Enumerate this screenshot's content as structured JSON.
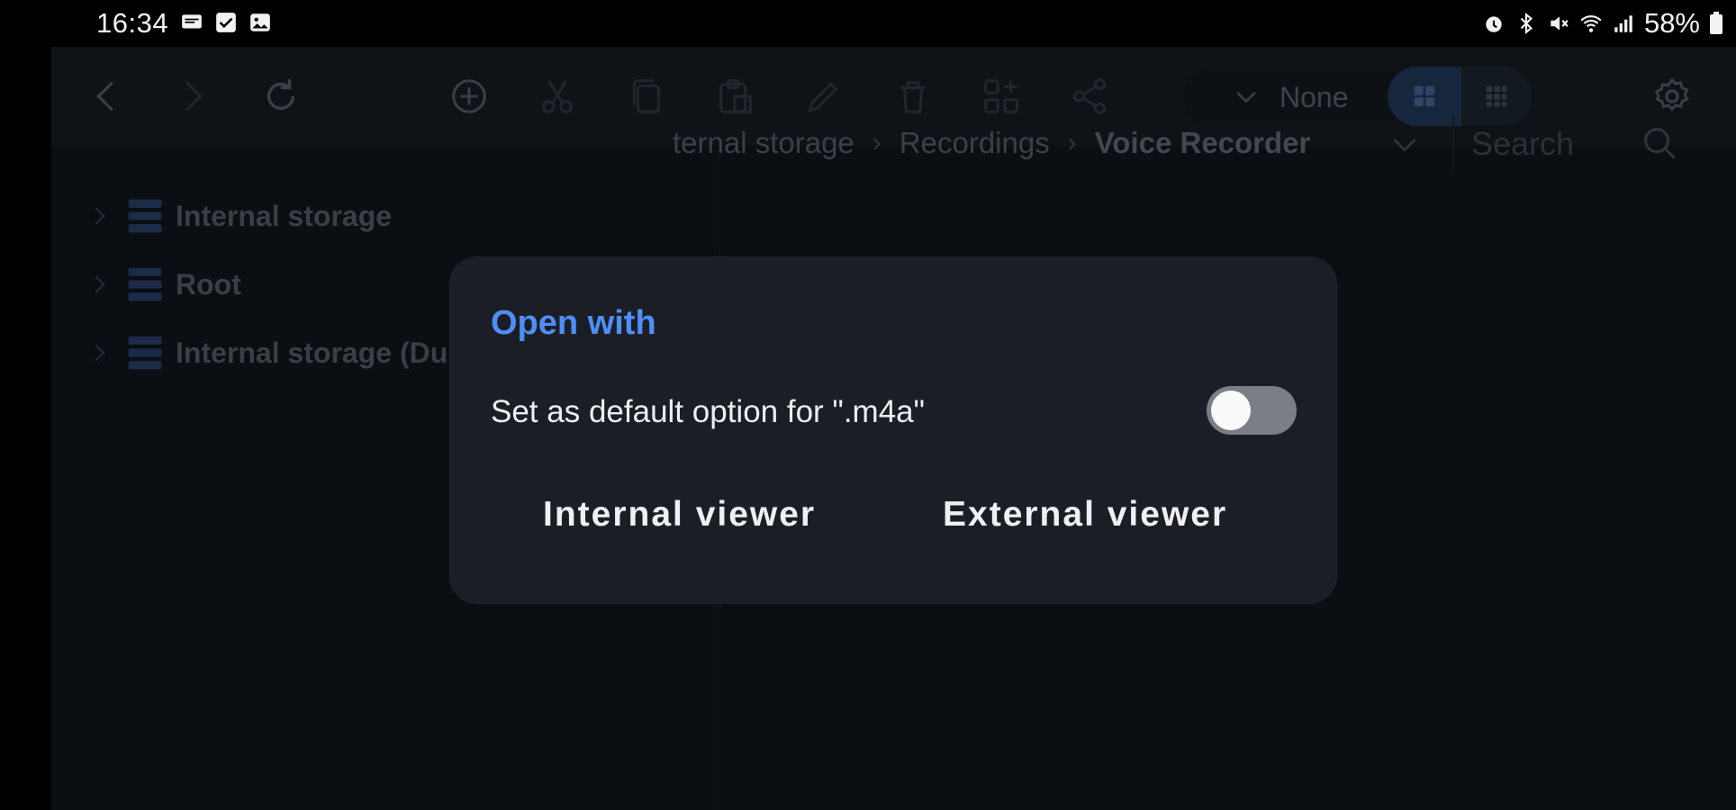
{
  "status_bar": {
    "time": "16:34",
    "left_icons": [
      "message-icon",
      "check-icon",
      "image-icon"
    ],
    "right_icons": [
      "alarm-icon",
      "bluetooth-icon",
      "mute-icon",
      "wifi-icon",
      "signal-icon"
    ],
    "battery": "58%"
  },
  "toolbar": {
    "buttons": [
      "back",
      "forward",
      "refresh",
      "add",
      "cut",
      "copy",
      "paste",
      "rename",
      "delete",
      "select",
      "share"
    ],
    "sort_value": "None",
    "view_modes": [
      "grid-large",
      "grid-small"
    ],
    "active_view": "grid-large"
  },
  "sidebar": {
    "items": [
      {
        "label": "Internal storage"
      },
      {
        "label": "Root"
      },
      {
        "label": "Internal storage (Du"
      }
    ]
  },
  "breadcrumb": {
    "items": [
      "ternal storage",
      "Recordings",
      "Voice Recorder"
    ]
  },
  "search": {
    "placeholder": "Search"
  },
  "dialog": {
    "title": "Open with",
    "default_option_label": "Set as default option for \".m4a\"",
    "default_toggle_on": false,
    "buttons": {
      "internal": "Internal viewer",
      "external": "External viewer"
    }
  },
  "colors": {
    "accent": "#4f8ef7",
    "dialog_bg": "#1b1f25",
    "app_bg": "#0b0e12"
  }
}
